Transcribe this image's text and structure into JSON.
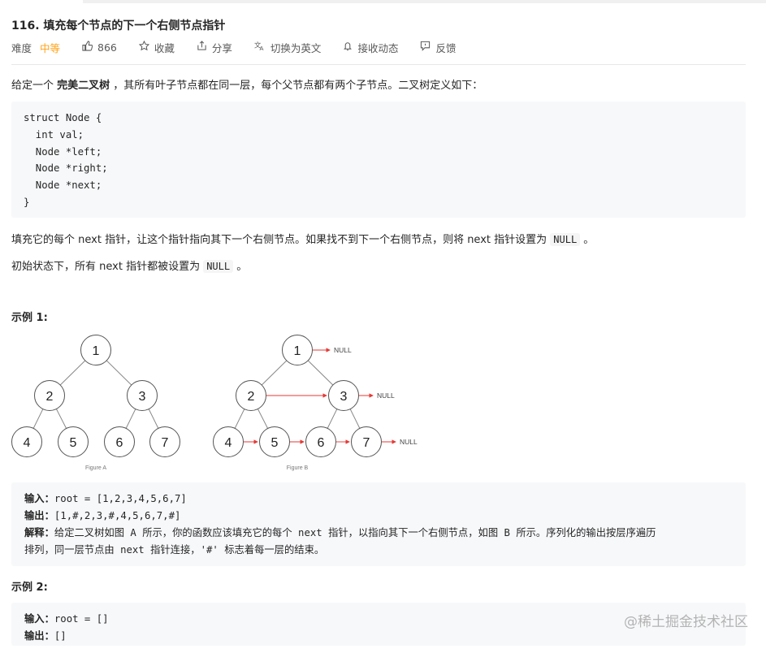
{
  "problem": {
    "title": "116. 填充每个节点的下一个右侧节点指针",
    "difficulty_label": "难度",
    "difficulty": "中等",
    "likes": "866",
    "collect": "收藏",
    "share": "分享",
    "switch_lang": "切换为英文",
    "subscribe": "接收动态",
    "feedback": "反馈"
  },
  "description": {
    "intro_pre": "给定一个 ",
    "intro_bold": "完美二叉树",
    "intro_post": " ，其所有叶子节点都在同一层，每个父节点都有两个子节点。二叉树定义如下：",
    "code": "struct Node {\n  int val;\n  Node *left;\n  Node *right;\n  Node *next;\n}",
    "para1_pre": "填充它的每个 next 指针，让这个指针指向其下一个右侧节点。如果找不到下一个右侧节点，则将 next 指针设置为 ",
    "para1_code": "NULL",
    "para1_post": " 。",
    "para2_pre": "初始状态下，所有 next 指针都被设置为 ",
    "para2_code": "NULL",
    "para2_post": " 。"
  },
  "example1": {
    "title": "示例 1:",
    "figure_a_caption": "Figure A",
    "figure_b_caption": "Figure B",
    "nodes": [
      "1",
      "2",
      "3",
      "4",
      "5",
      "6",
      "7"
    ],
    "null_label": "NULL",
    "input_label": "输入：",
    "input_value": "root = [1,2,3,4,5,6,7]",
    "output_label": "输出：",
    "output_value": "[1,#,2,3,#,4,5,6,7,#]",
    "explain_label": "解释：",
    "explain_line1": "给定二叉树如图 A 所示，你的函数应该填充它的每个 next 指针，以指向其下一个右侧节点，如图 B 所示。序列化的输出按层序遍历",
    "explain_line2": "排列，同一层节点由 next 指针连接，'#' 标志着每一层的结束。"
  },
  "example2": {
    "title": "示例 2:",
    "input_label": "输入：",
    "input_value": "root = []",
    "output_label": "输出：",
    "output_value": "[]"
  },
  "watermark": "@稀土掘金技术社区",
  "colors": {
    "accent": "#ffa116",
    "arrow": "#e53935"
  }
}
